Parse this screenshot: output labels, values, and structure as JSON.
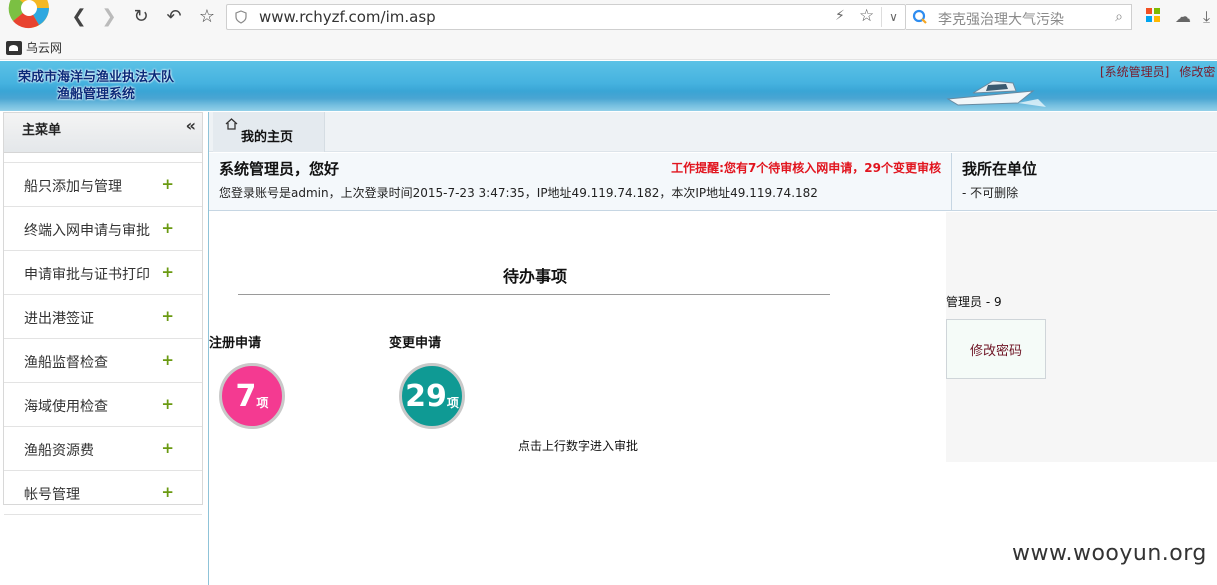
{
  "browser": {
    "url": "www.rchyzf.com/im.asp",
    "search_placeholder": "李克强治理大气污染",
    "bookmark": "乌云网"
  },
  "header": {
    "title_line1": "荣成市海洋与渔业执法大队",
    "title_line2": "渔船管理系统",
    "link_admin": "[系统管理员]",
    "link_edit": "修改密"
  },
  "sidebar": {
    "title": "主菜单",
    "items": [
      {
        "label": "船只添加与管理"
      },
      {
        "label": "终端入网申请与审批"
      },
      {
        "label": "申请审批与证书打印"
      },
      {
        "label": "进出港签证"
      },
      {
        "label": "渔船监督检查"
      },
      {
        "label": "海域使用检查"
      },
      {
        "label": "渔船资源费"
      },
      {
        "label": "帐号管理"
      }
    ]
  },
  "tabs": {
    "home": "我的主页"
  },
  "welcome": {
    "greeting": "系统管理员，您好",
    "alert": "工作提醒:您有7个待审核入网申请，29个变更审核",
    "login_info": "您登录账号是admin，上次登录时间2015-7-23 3:47:35，IP地址49.119.74.182，本次IP地址49.119.74.182"
  },
  "unit": {
    "title": "我所在单位",
    "value": "- 不可删除"
  },
  "todo": {
    "title": "待办事项",
    "reg_label": "注册申请",
    "reg_count": "7",
    "chg_label": "变更申请",
    "chg_count": "29",
    "unit": "项",
    "hint": "点击上行数字进入审批"
  },
  "right": {
    "admin_count": "管理员 - 9",
    "change_password": "修改密码"
  },
  "watermark": "www.wooyun.org"
}
